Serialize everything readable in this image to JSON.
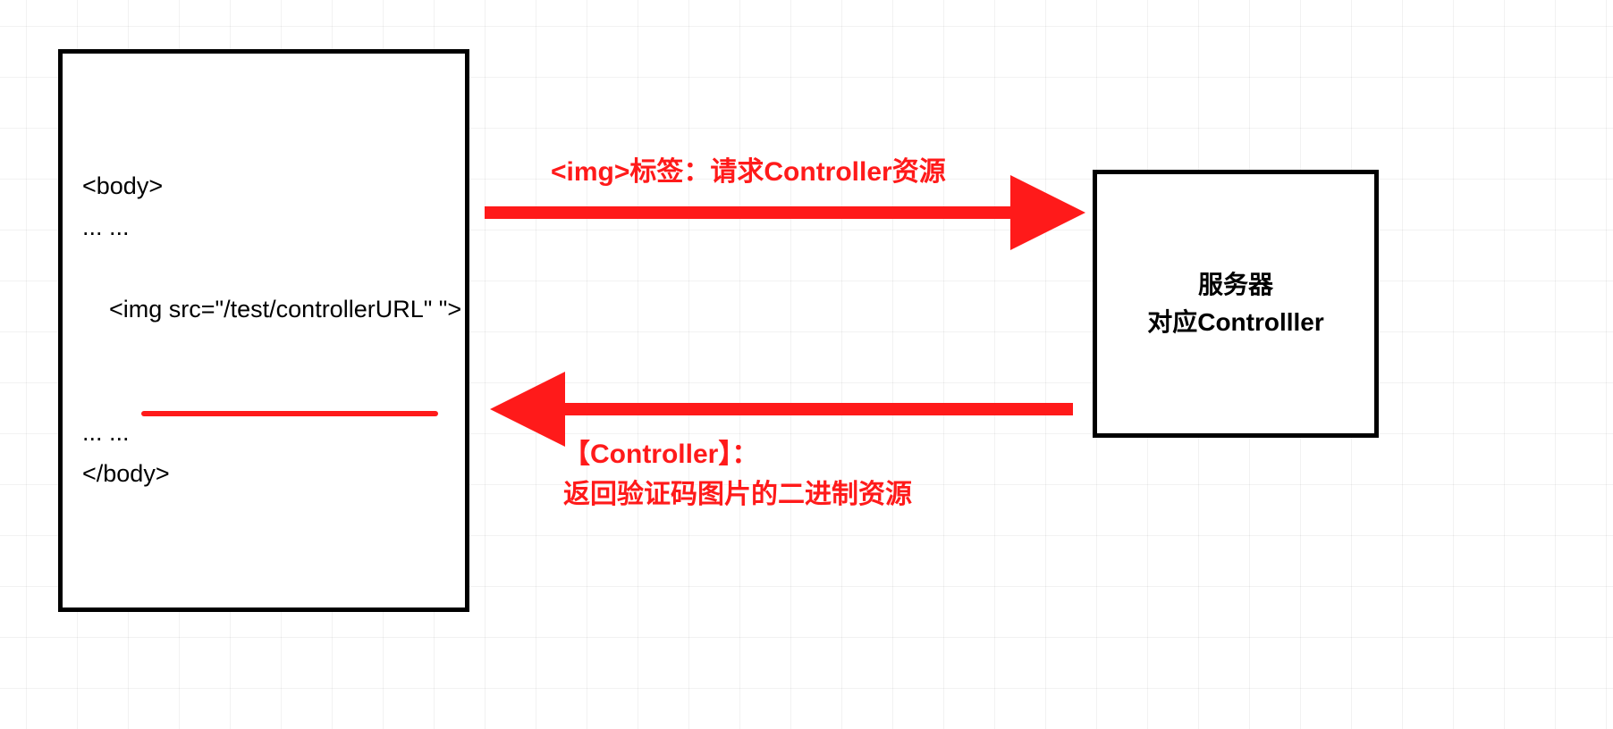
{
  "diagram": {
    "code_box": {
      "lines": [
        "<body>",
        "... ...",
        "<img src=\"/test/controllerURL\" \">",
        "... ...",
        "</body>"
      ],
      "underline_line_index": 2
    },
    "server_box": {
      "line1": "服务器",
      "line2": "对应Controlller"
    },
    "arrow_top": {
      "label": "<img>标签：请求Controller资源"
    },
    "arrow_bottom": {
      "label_line1": "【Controller】：",
      "label_line2": "返回验证码图片的二进制资源"
    },
    "colors": {
      "arrow": "#ff1a1a",
      "box_border": "#000000",
      "grid_line": "rgba(0,0,0,0.05)"
    }
  }
}
